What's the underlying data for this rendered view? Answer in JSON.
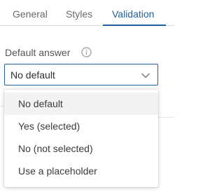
{
  "tabs": [
    {
      "label": "General"
    },
    {
      "label": "Styles"
    },
    {
      "label": "Validation",
      "active": true
    }
  ],
  "field": {
    "label": "Default answer",
    "info_icon": "info-circle-icon",
    "selected_value": "No default",
    "chevron_icon": "chevron-down-icon"
  },
  "menu": {
    "items": [
      {
        "label": "No default",
        "highlighted": true
      },
      {
        "label": "Yes (selected)"
      },
      {
        "label": "No (not selected)"
      },
      {
        "label": "Use a placeholder"
      }
    ]
  },
  "colors": {
    "accent": "#1f5e9c",
    "hover_bg": "#f2f2f2",
    "text": "#3a3a3a",
    "muted_text": "#6a6a6a"
  }
}
